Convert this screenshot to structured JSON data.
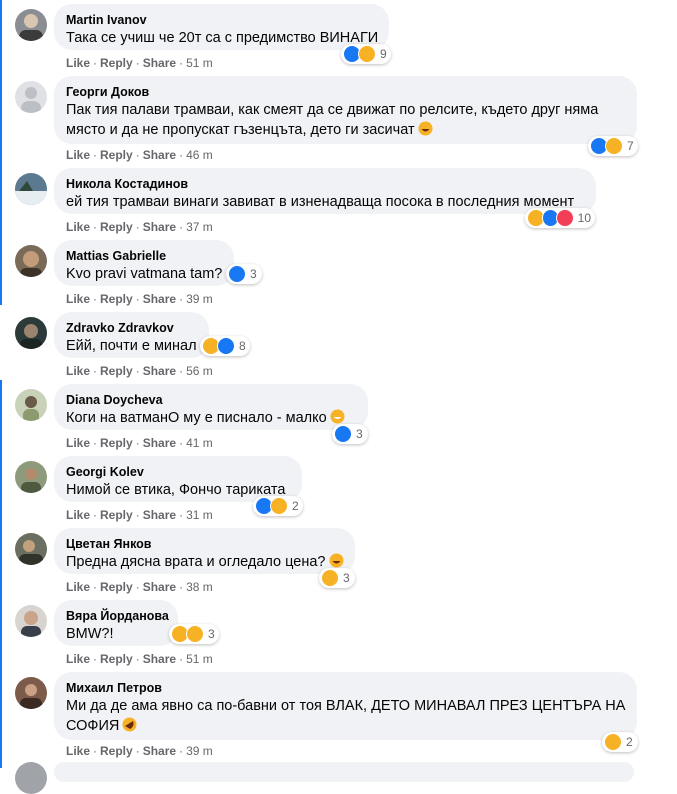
{
  "actions": {
    "like": "Like",
    "reply": "Reply",
    "share": "Share",
    "dot": "·"
  },
  "comments": [
    {
      "name": "Martin Ivanov",
      "text": "Така се учиш че 20т са с предимство ВИНАГИ",
      "count": "9",
      "time": "51 m",
      "reactions": [
        "like",
        "haha"
      ]
    },
    {
      "name": "Георги Доков",
      "text_lines": [
        "Пак тия палави трамваи, как смеят да се движат по релсите, където друг няма",
        "място и да не пропускат гъзенцъта, дето ги засичат"
      ],
      "count": "7",
      "time": "46 m",
      "reactions": [
        "like",
        "haha"
      ],
      "emoji": "haha-emoji"
    },
    {
      "name": "Никола Костадинов",
      "text": "ей тия трамваи винаги завиват в изненадваща посока в последния момент",
      "count": "10",
      "time": "37 m",
      "reactions": [
        "haha",
        "like",
        "love"
      ]
    },
    {
      "name": "Mattias Gabrielle",
      "text": "Kvo pravi vatmana tam?",
      "count": "3",
      "time": "39 m",
      "reactions": [
        "like"
      ]
    },
    {
      "name": "Zdravko Zdravkov",
      "text": "Ейй, почти е минал",
      "count": "8",
      "time": "56 m",
      "reactions": [
        "haha",
        "like"
      ]
    },
    {
      "name": "Diana Doycheva",
      "text": "Коги на ватманО му е писнало - малко",
      "count": "3",
      "time": "41 m",
      "reactions": [
        "like"
      ],
      "emoji": "grin-emoji"
    },
    {
      "name": "Georgi Kolev",
      "text": "Нимой се втика, Фончо тариката",
      "count": "2",
      "time": "31 m",
      "reactions": [
        "like",
        "haha"
      ]
    },
    {
      "name": "Цветан Янков",
      "text": "Предна дясна врата и огледало цена?",
      "count": "3",
      "time": "38 m",
      "reactions": [
        "haha"
      ],
      "emoji": "haha-emoji"
    },
    {
      "name": "Вяра Йорданова",
      "text": "BMW?!",
      "count": "3",
      "time": "51 m",
      "reactions": [
        "haha",
        "wow"
      ]
    },
    {
      "name": "Михаил Петров",
      "text_lines": [
        "Ми да де ама явно са по-бавни от тоя ВЛАК, ДЕТО МИНАВАЛ ПРЕЗ ЦЕНТЪРА НА",
        "СОФИЯ"
      ],
      "count": "2",
      "time": "39 m",
      "reactions": [
        "haha"
      ],
      "emoji": "rofl-emoji"
    }
  ],
  "colors": {
    "like": "#1877f2",
    "haha": "#f7b125",
    "love": "#f33e58",
    "bubble": "#f0f2f5",
    "meta": "#65676b"
  }
}
